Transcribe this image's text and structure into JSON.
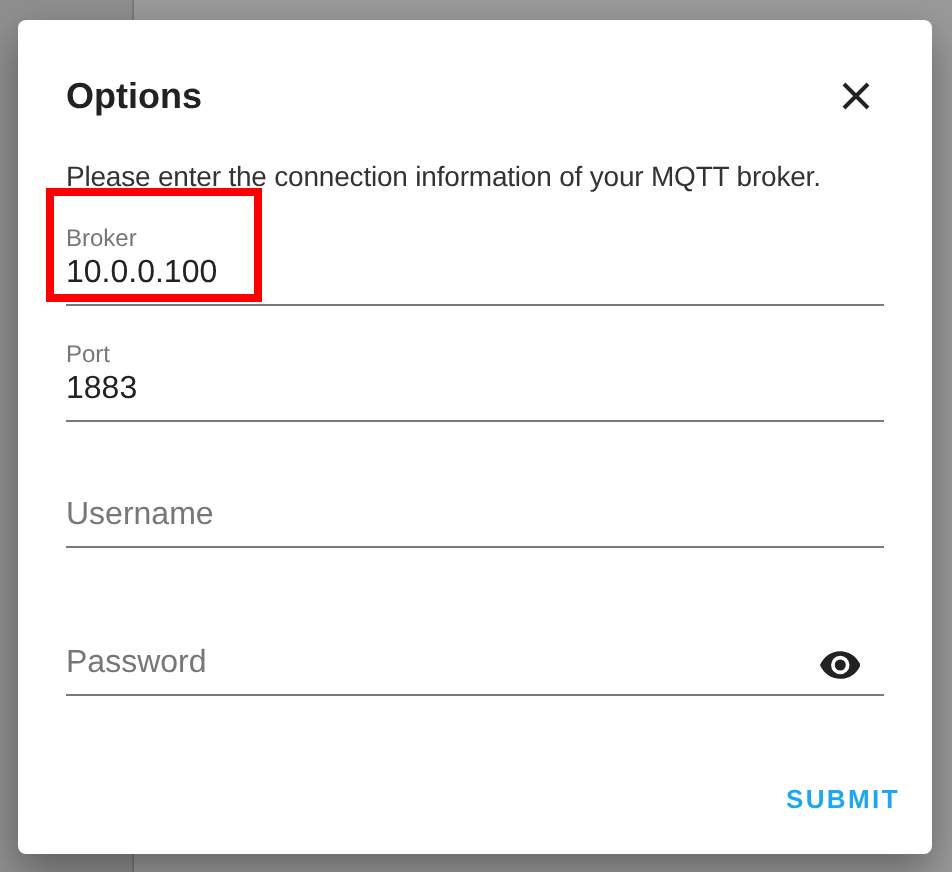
{
  "dialog": {
    "title": "Options",
    "description": "Please enter the connection information of your MQTT broker.",
    "fields": [
      {
        "kind": "text",
        "label": "Broker",
        "value": "10.0.0.100",
        "highlighted": true
      },
      {
        "kind": "text",
        "label": "Port",
        "value": "1883",
        "highlighted": false
      },
      {
        "kind": "text",
        "placeholder": "Username",
        "highlighted": false
      },
      {
        "kind": "password",
        "placeholder": "Password",
        "highlighted": false
      }
    ],
    "submit": "SUBMIT"
  }
}
